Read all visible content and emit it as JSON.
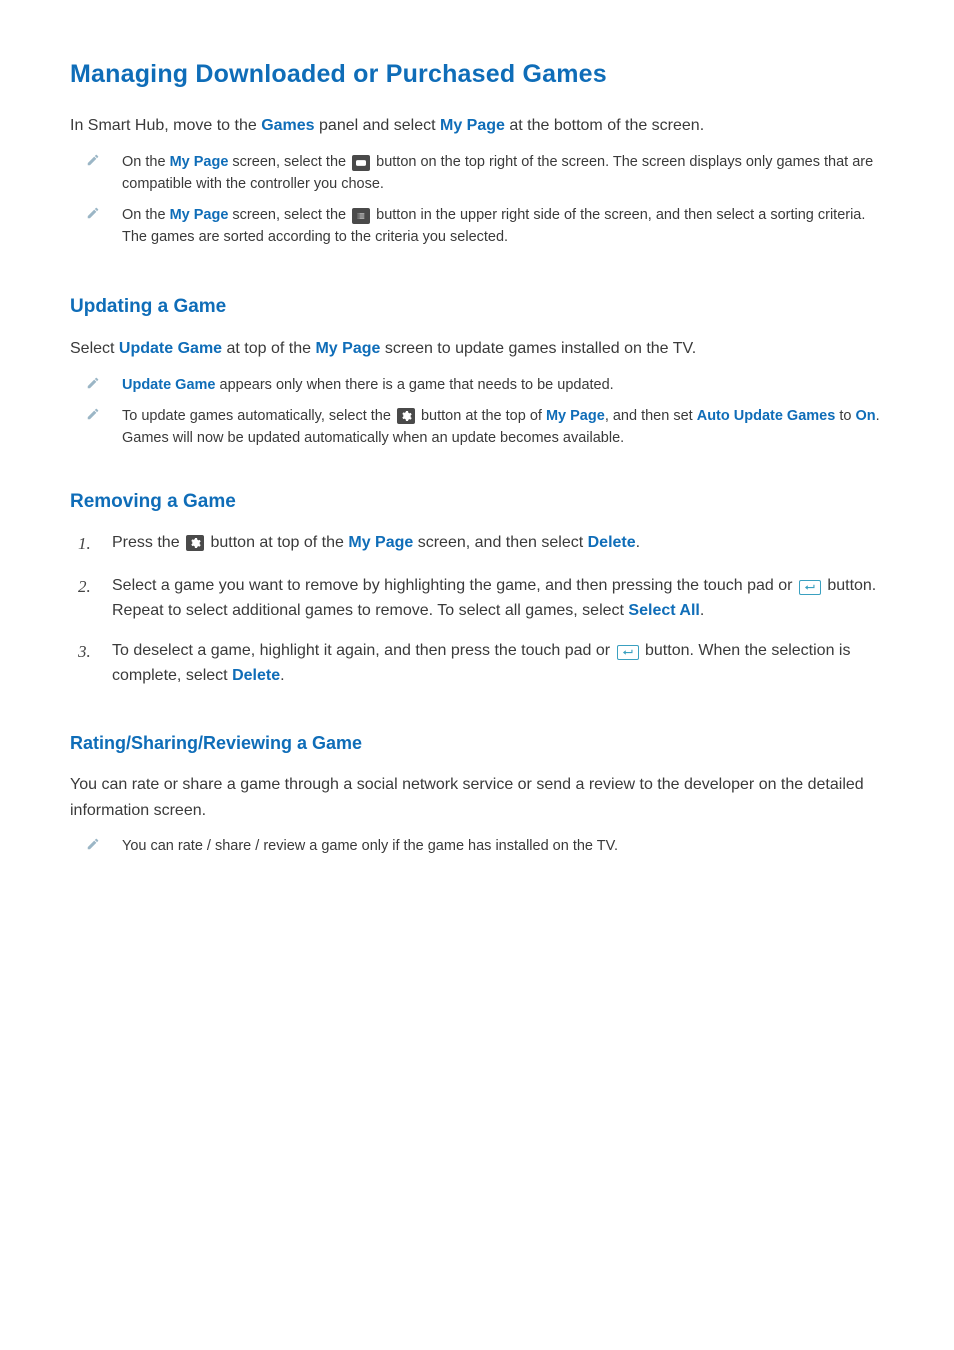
{
  "title": "Managing Downloaded or Purchased Games",
  "intro": {
    "pre": "In Smart Hub, move to the ",
    "games": "Games",
    "mid": " panel and select ",
    "mypage": "My Page",
    "post": " at the bottom of the screen."
  },
  "notes": {
    "n1": {
      "a": "On the ",
      "mypage": "My Page",
      "b": " screen, select the ",
      "c": " button on the top right of the screen. The screen displays only games that are compatible with the controller you chose."
    },
    "n2": {
      "a": "On the ",
      "mypage": "My Page",
      "b": " screen, select the ",
      "c": " button in the upper right side of the screen, and then select a sorting criteria. The games are sorted according to the criteria you selected."
    }
  },
  "updating": {
    "heading": "Updating a Game",
    "intro": {
      "a": "Select ",
      "update_game": "Update Game",
      "b": " at top of the ",
      "mypage": "My Page",
      "c": " screen to update games installed on the TV."
    },
    "note1": {
      "update_game": "Update Game",
      "a": " appears only when there is a game that needs to be updated."
    },
    "note2": {
      "a": "To update games automatically, select the ",
      "b": " button at the top of ",
      "mypage": "My Page",
      "c": ", and then set ",
      "auto": "Auto Update Games",
      "d": " to ",
      "on": "On",
      "e": ". Games will now be updated automatically when an update becomes available."
    }
  },
  "removing": {
    "heading": "Removing a Game",
    "steps": {
      "s1": {
        "num": "1.",
        "a": "Press the ",
        "b": " button at top of the ",
        "mypage": "My Page",
        "c": " screen, and then select ",
        "delete": "Delete",
        "d": "."
      },
      "s2": {
        "num": "2.",
        "a": "Select a game you want to remove by highlighting the game, and then pressing the touch pad or ",
        "b": " button. Repeat to select additional games to remove. To select all games, select ",
        "selectall": "Select All",
        "c": "."
      },
      "s3": {
        "num": "3.",
        "a": "To deselect a game, highlight it again, and then press the touch pad or ",
        "b": " button. When the selection is complete, select ",
        "delete": "Delete",
        "c": "."
      }
    }
  },
  "rating": {
    "heading": "Rating/Sharing/Reviewing a Game",
    "intro": "You can rate or share a game through a social network service or send a review to the developer on the detailed information screen.",
    "note": "You can rate / share / review a game only if the game has installed on the TV."
  }
}
